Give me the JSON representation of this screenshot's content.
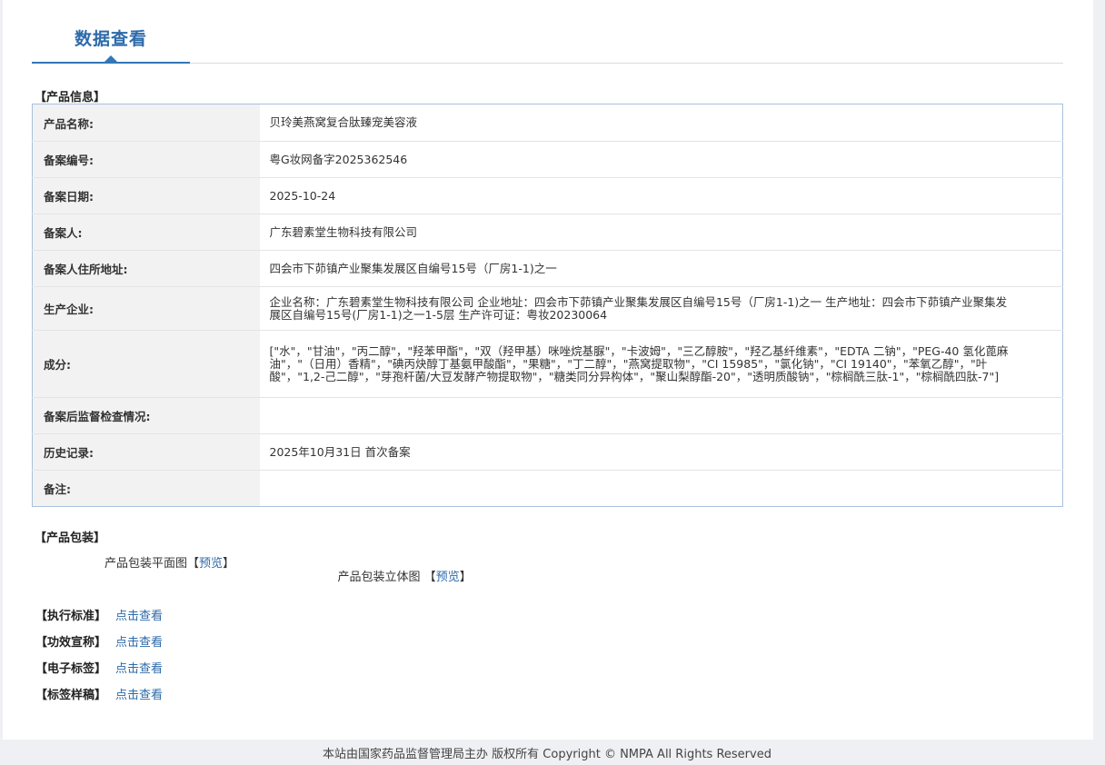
{
  "tab": {
    "title": "数据查看"
  },
  "product_info": {
    "section_title": "【产品信息】",
    "rows": [
      {
        "label": "产品名称:",
        "value": "贝玲美燕窝复合肽臻宠美容液"
      },
      {
        "label": "备案编号:",
        "value": "粤G妆网备字2025362546"
      },
      {
        "label": "备案日期:",
        "value": "2025-10-24"
      },
      {
        "label": "备案人:",
        "value": "广东碧素堂生物科技有限公司"
      },
      {
        "label": "备案人住所地址:",
        "value": "四会市下茆镇产业聚集发展区自编号15号（厂房1-1)之一"
      },
      {
        "label": "生产企业:",
        "value": "企业名称：广东碧素堂生物科技有限公司 企业地址：四会市下茆镇产业聚集发展区自编号15号（厂房1-1)之一 生产地址：四会市下茆镇产业聚集发展区自编号15号(厂房1-1)之一1-5层 生产许可证：粤妆20230064"
      },
      {
        "label": "成分:",
        "value": "[\"水\"，\"甘油\"，\"丙二醇\"，\"羟苯甲酯\"，\"双（羟甲基）咪唑烷基脲\"，\"卡波姆\"，\"三乙醇胺\"，\"羟乙基纤维素\"，\"EDTA 二钠\"，\"PEG-40 氢化蓖麻油\"，\"（日用）香精\"，\"碘丙炔醇丁基氨甲酸酯\"，\"果糖\"，\"丁二醇\"，\"燕窝提取物\"，\"CI 15985\"，\"氯化钠\"，\"CI 19140\"，\"苯氧乙醇\"，\"叶酸\"，\"1,2-己二醇\"，\"芽孢杆菌/大豆发酵产物提取物\"，\"糖类同分异构体\"，\"聚山梨醇酯-20\"，\"透明质酸钠\"，\"棕榈酰三肽-1\"，\"棕榈酰四肽-7\"]"
      },
      {
        "label": "备案后监督检查情况:",
        "value": ""
      },
      {
        "label": "历史记录:",
        "value": "2025年10月31日 首次备案"
      },
      {
        "label": "备注:",
        "value": ""
      }
    ]
  },
  "packaging": {
    "section_title": "【产品包装】",
    "flat_label": "产品包装平面图",
    "flat_link": "预览",
    "solid_label": "产品包装立体图 ",
    "solid_link": "预览"
  },
  "links": [
    {
      "label": "【执行标准】",
      "link": "点击查看"
    },
    {
      "label": "【功效宣称】",
      "link": "点击查看"
    },
    {
      "label": "【电子标签】",
      "link": "点击查看"
    },
    {
      "label": "【标签样稿】",
      "link": "点击查看"
    }
  ],
  "footer": {
    "text": "本站由国家药品监督管理局主办 版权所有 Copyright © NMPA All Rights Reserved"
  }
}
